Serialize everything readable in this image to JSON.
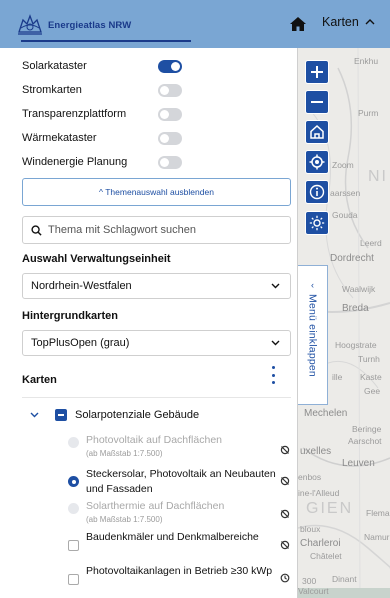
{
  "header": {
    "logo_text": "Energieatlas NRW",
    "karten_label": "Karten"
  },
  "toggles": [
    {
      "label": "Solarkataster",
      "on": true
    },
    {
      "label": "Stromkarten",
      "on": false
    },
    {
      "label": "Transparenzplattform",
      "on": false
    },
    {
      "label": "Wärmekataster",
      "on": false
    },
    {
      "label": "Windenergie Planung",
      "on": false
    }
  ],
  "theme_button": "^ Themenauswahl ausblenden",
  "search": {
    "placeholder": "Thema mit Schlagwort suchen"
  },
  "verwaltung": {
    "label": "Auswahl Verwaltungseinheit",
    "value": "Nordrhein-Westfalen"
  },
  "hintergrund": {
    "label": "Hintergrundkarten",
    "value": "TopPlusOpen (grau)"
  },
  "karten": {
    "title": "Karten",
    "group_label": "Solarpotenziale Gebäude",
    "items": [
      {
        "label": "Photovoltaik auf Dachflächen",
        "sub": "(ab Maßstab 1:7.500)",
        "state": "disabled"
      },
      {
        "label": "Steckersolar, Photovoltaik an Neubauten und Fassaden",
        "sub": "",
        "state": "checked"
      },
      {
        "label": "Solarthermie auf Dachflächen",
        "sub": "(ab Maßstab 1:7.500)",
        "state": "disabled"
      },
      {
        "label": "Baudenkmäler und Denkmalbereiche",
        "sub": "",
        "state": "unchecked"
      },
      {
        "label": "Photovoltaikanlagen in Betrieb ≥30 kWp",
        "sub": "",
        "state": "unchecked"
      }
    ]
  },
  "side_tab": {
    "label": "Menü einklappen"
  },
  "map_labels": {
    "l1": "Enkhu",
    "l2": "Purm",
    "l3": "Zoom",
    "l4": "NI",
    "l5": "aarssen",
    "l6": "Gouda",
    "l7": "Leerd",
    "l8": "Dordrecht",
    "l9": "Waalwijk",
    "l10": "Breda",
    "l11": "Hoogstrate",
    "l12": "Turnh",
    "l13": "ille",
    "l14": "Kaste",
    "l15": "Gee",
    "l16": "Mechelen",
    "l17": "Beringe",
    "l18": "Aarschot",
    "l19": "uxelles",
    "l20": "Leuven",
    "l21": "enbos",
    "l22": "ine-l'Alleud",
    "l23": "GIEN",
    "l24": "Flema",
    "l25": "bloux",
    "l26": "Charleroi",
    "l27": "Namur",
    "l28": "Châtelet",
    "l29": "300",
    "l30": "Dinant",
    "l31": "Valcourt"
  }
}
